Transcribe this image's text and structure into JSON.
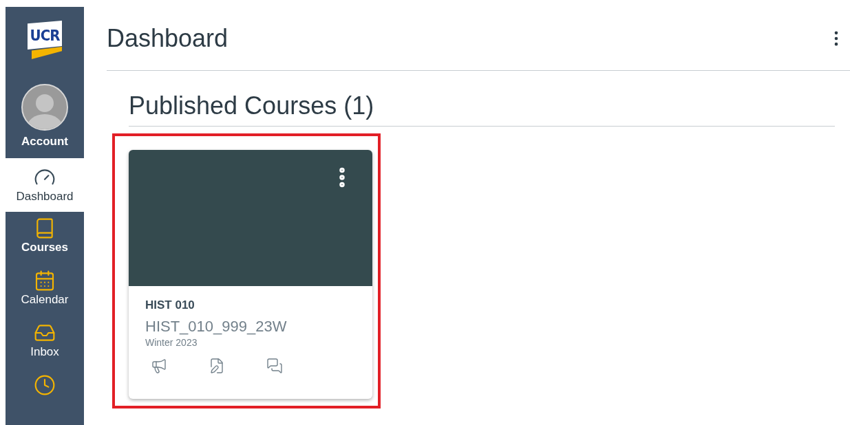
{
  "sidebar": {
    "logo": "UCR",
    "account": {
      "label": "Account"
    },
    "items": [
      {
        "label": "Dashboard",
        "selected": true,
        "emphasized": false
      },
      {
        "label": "Courses",
        "selected": false,
        "emphasized": true
      },
      {
        "label": "Calendar",
        "selected": false,
        "emphasized": false
      },
      {
        "label": "Inbox",
        "selected": false,
        "emphasized": false
      },
      {
        "selected": false
      }
    ]
  },
  "header": {
    "title": "Dashboard"
  },
  "section": {
    "title": "Published Courses (1)"
  },
  "cards": [
    {
      "code": "HIST 010",
      "name": "HIST_010_999_23W",
      "term": "Winter 2023",
      "color": "#344a4e",
      "highlighted": true
    }
  ]
}
